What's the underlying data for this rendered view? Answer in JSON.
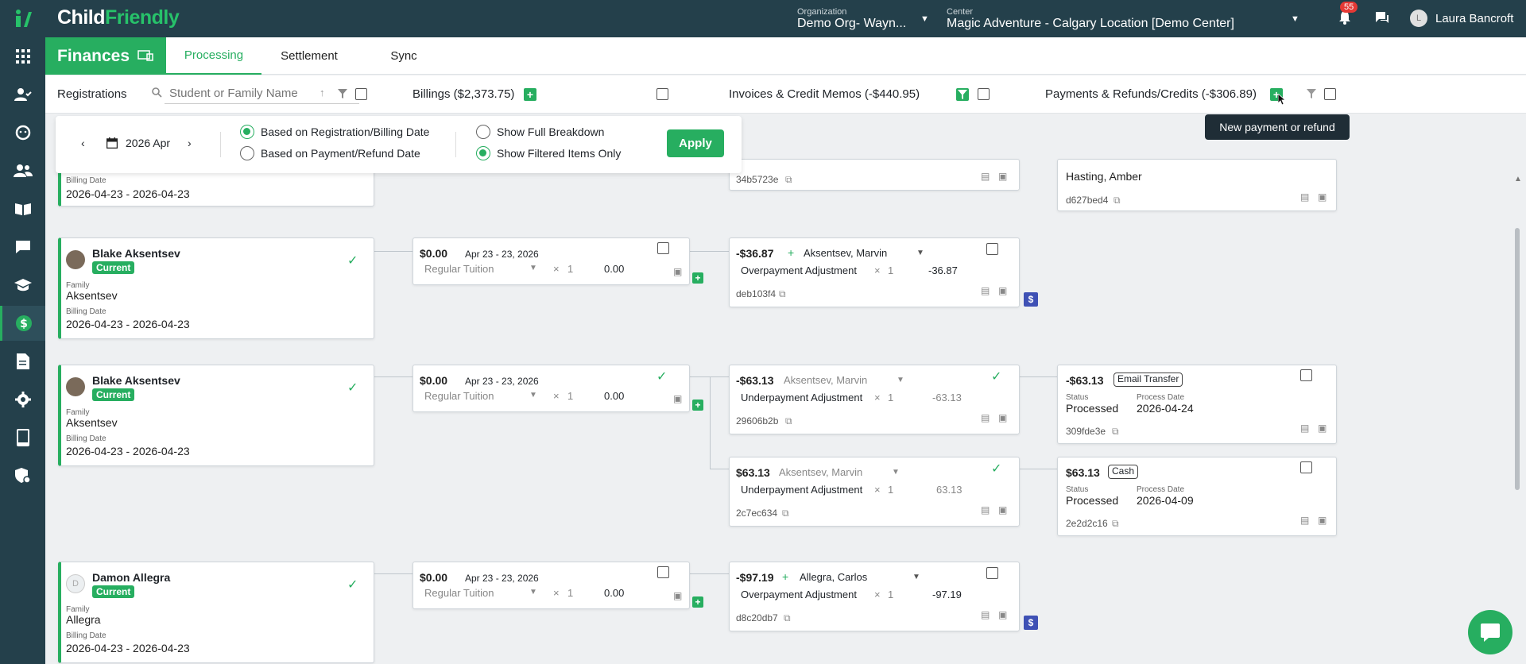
{
  "brand": {
    "child": "Child",
    "friendly": "Friendly",
    "accent": "#27ae60",
    "dark": "#24404b"
  },
  "topbar": {
    "org_label": "Organization",
    "org_value": "Demo Org- Wayn...",
    "center_label": "Center",
    "center_value": "Magic Adventure - Calgary Location [Demo Center]",
    "notif_count": "55",
    "user_initial": "L",
    "user_name": "Laura Bancroft"
  },
  "sidebar": {
    "items": [
      "apps-icon",
      "user-check-icon",
      "child-face-icon",
      "people-icon",
      "book-icon",
      "chat-icon",
      "graduation-icon",
      "dollar-icon",
      "document-icon",
      "settings-icon",
      "tablet-icon",
      "shield-gear-icon"
    ]
  },
  "header": {
    "title": "Finances",
    "tabs": [
      "Processing",
      "Settlement",
      "Sync"
    ]
  },
  "filters": {
    "registrations": "Registrations",
    "search_placeholder": "Student or Family Name",
    "billings": "Billings ($2,373.75)",
    "invoices": "Invoices & Credit Memos (-$440.95)",
    "payments": "Payments & Refunds/Credits (-$306.89)"
  },
  "panel": {
    "date": "2026 Apr",
    "opt1": "Based on Registration/Billing Date",
    "opt2": "Based on Payment/Refund Date",
    "opt3": "Show Full Breakdown",
    "opt4": "Show Filtered Items Only",
    "apply": "Apply"
  },
  "tooltip": "New payment or refund",
  "labels": {
    "family": "Family",
    "billing_date": "Billing Date",
    "current": "Current",
    "status": "Status",
    "process_date": "Process Date",
    "x": "×",
    "dollar": "$"
  },
  "top_partial": {
    "billing_date": "2026-04-23 - 2026-04-23",
    "invoice_hash": "34b5723e",
    "payment_name": "Hasting, Amber",
    "payment_hash": "d627bed4"
  },
  "rows": [
    {
      "student": {
        "name": "Blake Aksentsev",
        "family": "Aksentsev",
        "dates": "2026-04-23 - 2026-04-23"
      },
      "billing": {
        "amount": "$0.00",
        "range": "Apr 23 - 23, 2026",
        "item": "Regular Tuition",
        "qty": "1",
        "total": "0.00"
      },
      "invoices": [
        {
          "amount": "-$36.87",
          "person": "Aksentsev, Marvin",
          "item": "Overpayment Adjustment",
          "qty": "1",
          "total": "-36.87",
          "hash": "deb103f4"
        }
      ]
    },
    {
      "student": {
        "name": "Blake Aksentsev",
        "family": "Aksentsev",
        "dates": "2026-04-23 - 2026-04-23"
      },
      "billing": {
        "amount": "$0.00",
        "range": "Apr 23 - 23, 2026",
        "item": "Regular Tuition",
        "qty": "1",
        "total": "0.00"
      },
      "invoices": [
        {
          "amount": "-$63.13",
          "person": "Aksentsev, Marvin",
          "item": "Underpayment Adjustment",
          "qty": "1",
          "total": "-63.13",
          "hash": "29606b2b"
        },
        {
          "amount": "$63.13",
          "person": "Aksentsev, Marvin",
          "item": "Underpayment Adjustment",
          "qty": "1",
          "total": "63.13",
          "hash": "2c7ec634"
        }
      ],
      "payments": [
        {
          "amount": "-$63.13",
          "method": "Email Transfer",
          "status": "Processed",
          "date": "2026-04-24",
          "hash": "309fde3e"
        },
        {
          "amount": "$63.13",
          "method": "Cash",
          "status": "Processed",
          "date": "2026-04-09",
          "hash": "2e2d2c16"
        }
      ]
    },
    {
      "student": {
        "name": "Damon Allegra",
        "initial": "D",
        "family": "Allegra",
        "dates": "2026-04-23 - 2026-04-23"
      },
      "billing": {
        "amount": "$0.00",
        "range": "Apr 23 - 23, 2026",
        "item": "Regular Tuition",
        "qty": "1",
        "total": "0.00"
      },
      "invoices": [
        {
          "amount": "-$97.19",
          "person": "Allegra, Carlos",
          "item": "Overpayment Adjustment",
          "qty": "1",
          "total": "-97.19",
          "hash": "d8c20db7"
        }
      ]
    }
  ]
}
